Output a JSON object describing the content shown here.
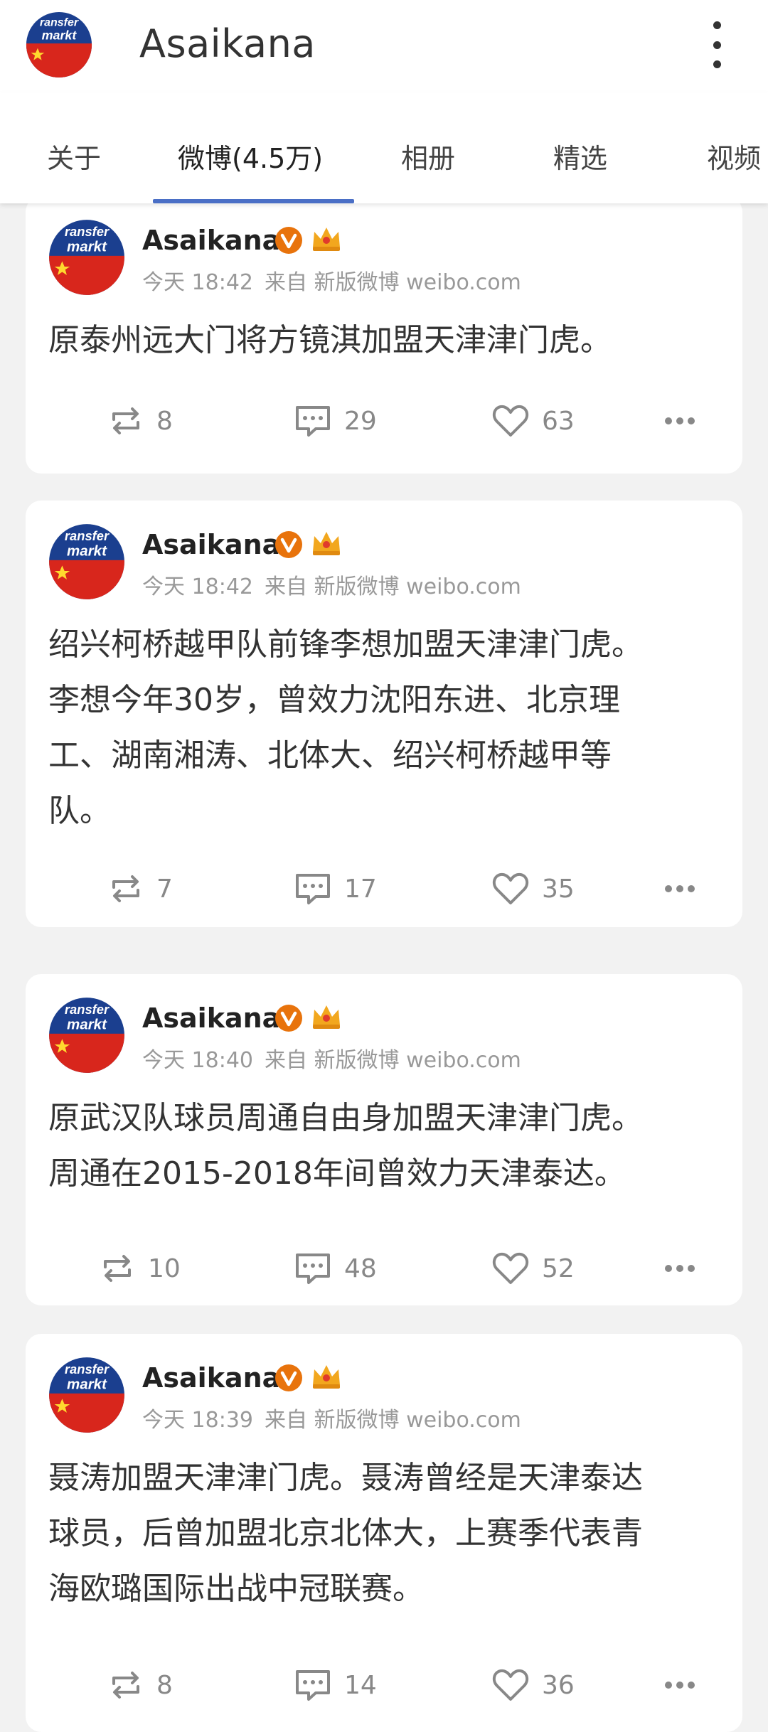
{
  "header": {
    "title": "Asaikana",
    "avatar_text": "ransfer markt"
  },
  "tabs": [
    {
      "label": "关于"
    },
    {
      "label": "微博(4.5万)",
      "active": true
    },
    {
      "label": "相册"
    },
    {
      "label": "精选"
    },
    {
      "label": "视频"
    }
  ],
  "posts": [
    {
      "author": "Asaikana",
      "time": "今天 18:42",
      "source": "来自 新版微博 weibo.com",
      "lines": [
        "原泰州远大门将方镜淇加盟天津津门虎。"
      ],
      "reposts": "8",
      "comments": "29",
      "likes": "63"
    },
    {
      "author": "Asaikana",
      "time": "今天 18:42",
      "source": "来自 新版微博 weibo.com",
      "lines": [
        "绍兴柯桥越甲队前锋李想加盟天津津门虎。",
        "李想今年30岁，曾效力沈阳东进、北京理",
        "工、湖南湘涛、北体大、绍兴柯桥越甲等",
        "队。"
      ],
      "reposts": "7",
      "comments": "17",
      "likes": "35"
    },
    {
      "author": "Asaikana",
      "time": "今天 18:40",
      "source": "来自 新版微博 weibo.com",
      "lines": [
        "原武汉队球员周通自由身加盟天津津门虎。",
        "周通在2015-2018年间曾效力天津泰达。"
      ],
      "reposts": "10",
      "comments": "48",
      "likes": "52"
    },
    {
      "author": "Asaikana",
      "time": "今天 18:39",
      "source": "来自 新版微博 weibo.com",
      "lines": [
        "聂涛加盟天津津门虎。聂涛曾经是天津泰达",
        "球员，后曾加盟北京北体大，上赛季代表青",
        "海欧璐国际出战中冠联赛。"
      ],
      "reposts": "8",
      "comments": "14",
      "likes": "36"
    }
  ],
  "colors": {
    "tab_indicator": "#4a6fc6",
    "verified_badge": "#e8730c",
    "crown": "#f2a71e",
    "avatar_flag": "#d8261c"
  },
  "icons": [
    "repost-icon",
    "comment-icon",
    "like-icon",
    "more-dots-icon",
    "verified-icon",
    "crown-icon",
    "more-vertical-icon"
  ]
}
